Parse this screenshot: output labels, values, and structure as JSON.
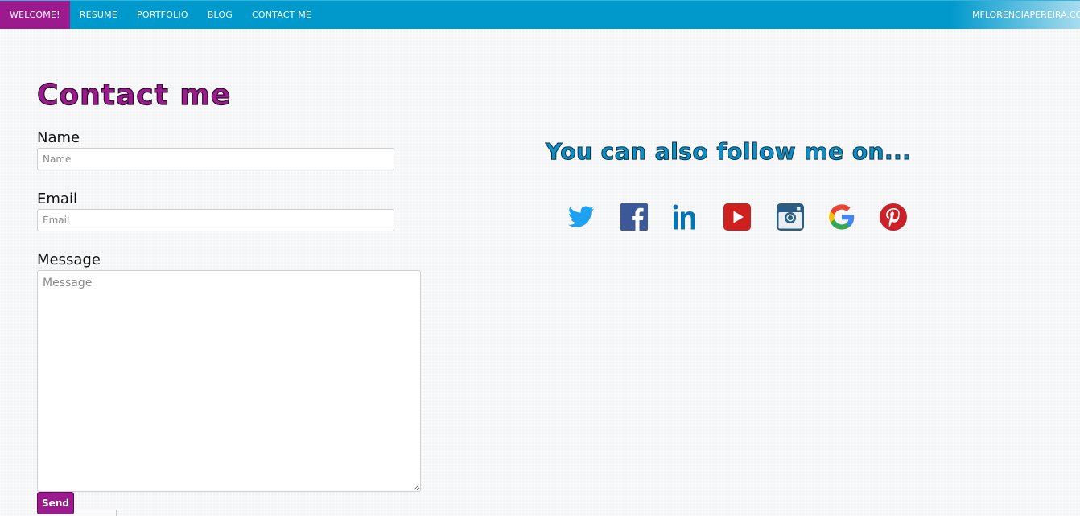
{
  "nav": {
    "items": [
      {
        "label": "WELCOME!",
        "active": true
      },
      {
        "label": "RESUME",
        "active": false
      },
      {
        "label": "PORTFOLIO",
        "active": false
      },
      {
        "label": "BLOG",
        "active": false
      },
      {
        "label": "CONTACT ME",
        "active": false
      }
    ],
    "brand": "MFLORENCIAPEREIRA.CO"
  },
  "contact": {
    "title": "Contact me",
    "name_label": "Name",
    "name_placeholder": "Name",
    "email_label": "Email",
    "email_placeholder": "Email",
    "message_label": "Message",
    "message_placeholder": "Message",
    "send_label": "Send"
  },
  "follow": {
    "title": "You can also follow me on...",
    "icons": [
      "twitter-icon",
      "facebook-icon",
      "linkedin-icon",
      "youtube-icon",
      "instagram-icon",
      "google-icon",
      "pinterest-icon"
    ]
  },
  "colors": {
    "nav_bg": "#0099cc",
    "accent": "#9b1b8f",
    "follow_title": "#0e8fc4",
    "twitter": "#1da1f2",
    "facebook": "#3b5998",
    "linkedin": "#0077b5",
    "youtube": "#cd201f",
    "instagram": "#2a5d84",
    "pinterest": "#cb2027"
  }
}
